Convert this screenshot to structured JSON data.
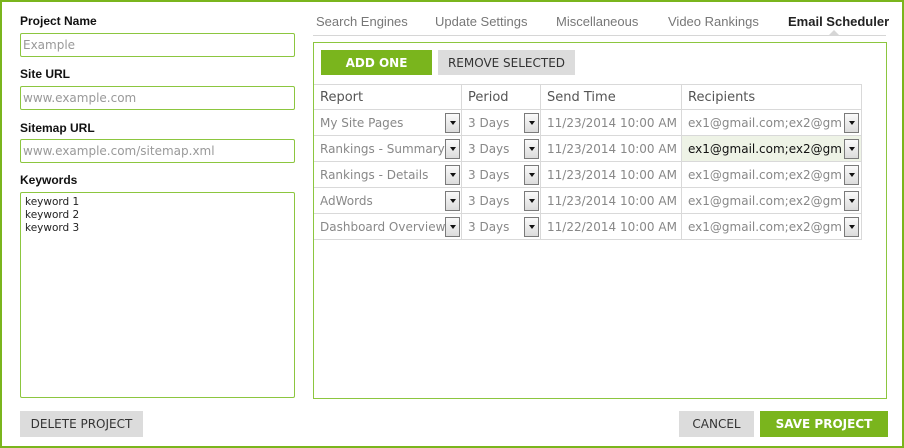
{
  "form": {
    "project_name_label": "Project Name",
    "project_name_placeholder": "Example",
    "site_url_label": "Site URL",
    "site_url_placeholder": "www.example.com",
    "sitemap_url_label": "Sitemap URL",
    "sitemap_url_placeholder": "www.example.com/sitemap.xml",
    "keywords_label": "Keywords",
    "keywords": [
      "keyword 1",
      "keyword 2",
      "keyword 3"
    ]
  },
  "tabs": [
    {
      "label": "Search Engines",
      "active": false
    },
    {
      "label": "Update Settings",
      "active": false
    },
    {
      "label": "Miscellaneous",
      "active": false
    },
    {
      "label": "Video Rankings",
      "active": false
    },
    {
      "label": "Email Scheduler",
      "active": true
    }
  ],
  "scheduler": {
    "add_label": "ADD ONE",
    "remove_label": "REMOVE SELECTED",
    "columns": [
      "Report",
      "Period",
      "Send Time",
      "Recipients"
    ],
    "rows": [
      {
        "report": "My Site Pages",
        "period": "3 Days",
        "send_time": "11/23/2014 10:00 AM",
        "recipients": "ex1@gmail.com;ex2@gm",
        "highlight": false
      },
      {
        "report": "Rankings - Summary",
        "period": "3 Days",
        "send_time": "11/23/2014 10:00 AM",
        "recipients": "ex1@gmail.com;ex2@gm",
        "highlight": true
      },
      {
        "report": "Rankings - Details",
        "period": "3 Days",
        "send_time": "11/23/2014 10:00 AM",
        "recipients": "ex1@gmail.com;ex2@gm",
        "highlight": false
      },
      {
        "report": "AdWords",
        "period": "3 Days",
        "send_time": "11/23/2014 10:00 AM",
        "recipients": "ex1@gmail.com;ex2@gm",
        "highlight": false
      },
      {
        "report": "Dashboard Overview",
        "period": "3 Days",
        "send_time": "11/22/2014 10:00 AM",
        "recipients": "ex1@gmail.com;ex2@gm",
        "highlight": false
      }
    ]
  },
  "footer": {
    "delete_label": "DELETE PROJECT",
    "cancel_label": "CANCEL",
    "save_label": "SAVE PROJECT"
  },
  "colors": {
    "accent": "#7ab51d",
    "border": "#8cc63f",
    "button_grey": "#dcdcdc"
  }
}
